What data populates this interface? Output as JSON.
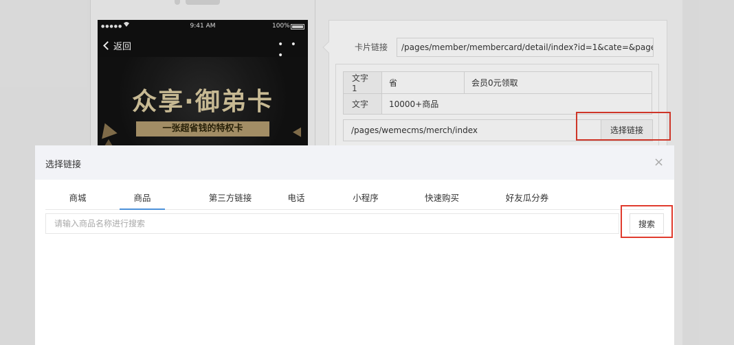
{
  "phone": {
    "signal": "●●●●●",
    "time": "9:41 AM",
    "battery": "100%",
    "back_label": "返回",
    "more_label": "• • •",
    "banner_title": "众享·御弟卡",
    "banner_subtitle": "一张超省钱的特权卡"
  },
  "config": {
    "card_link_label": "卡片链接",
    "card_link_value": "/pages/member/membercard/detail/index?id=1&cate=&page",
    "rows": [
      {
        "label": "文字1",
        "value": "省",
        "extra": "会员0元领取"
      },
      {
        "label": "文字",
        "value": "10000+商品"
      }
    ],
    "link_value": "/pages/wemecms/merch/index",
    "choose_link_label": "选择链接"
  },
  "modal": {
    "title": "选择链接",
    "close": "×",
    "tabs": [
      {
        "label": "商城"
      },
      {
        "label": "商品"
      },
      {
        "label": "第三方链接"
      },
      {
        "label": "电话"
      },
      {
        "label": "小程序"
      },
      {
        "label": "快速购买"
      },
      {
        "label": "好友瓜分券"
      }
    ],
    "active_tab": "商品",
    "search_placeholder": "请输入商品名称进行搜索",
    "search_value": "",
    "search_button": "搜索"
  },
  "colors": {
    "highlight": "#e03a2c",
    "active_tab": "#4a90d9"
  }
}
